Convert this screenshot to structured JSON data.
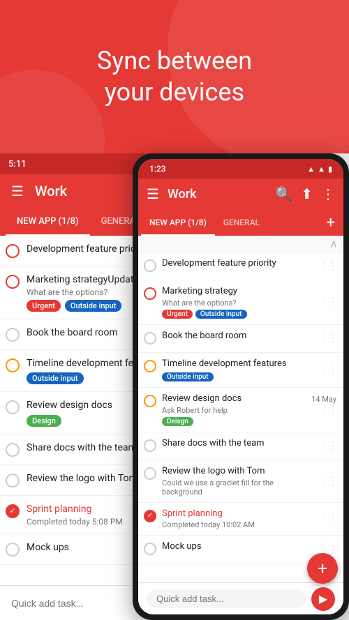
{
  "hero": {
    "title_line1": "Sync between",
    "title_line2": "your devices"
  },
  "status_bar": {
    "time": "5:11",
    "phone_time": "1:23",
    "battery_icon": "🔋",
    "wifi_icon": "▲",
    "signal_icon": "▲"
  },
  "toolbar": {
    "menu_icon": "☰",
    "title": "Work",
    "search_icon": "🔍",
    "share_icon": "⬆",
    "more_icon": "⋮"
  },
  "tabs": {
    "new_app": "NEW APP (1/8)",
    "general": "GENERAL",
    "add_icon": "+"
  },
  "tasks": [
    {
      "id": 1,
      "title": "Development feature priority",
      "subtitle": "",
      "circle": "empty",
      "tags": [],
      "date": "",
      "completed": false
    },
    {
      "id": 2,
      "title": "Marketing strategy",
      "subtitle": "What are the options?",
      "circle": "red-ring",
      "tags": [
        "Urgent",
        "Outside input"
      ],
      "date": "",
      "completed": false
    },
    {
      "id": 3,
      "title": "Book the board room",
      "subtitle": "",
      "circle": "empty",
      "tags": [],
      "date": "",
      "completed": false
    },
    {
      "id": 4,
      "title": "Timeline development features",
      "subtitle": "",
      "circle": "orange-ring",
      "tags": [
        "Outside input"
      ],
      "date": "",
      "completed": false
    },
    {
      "id": 5,
      "title": "Review design docs",
      "subtitle": "Ask Robert for help",
      "circle": "orange-ring",
      "tags": [
        "Deisgn"
      ],
      "date": "14 May",
      "completed": false
    },
    {
      "id": 6,
      "title": "Share docs with the team",
      "subtitle": "",
      "circle": "empty",
      "tags": [],
      "date": "",
      "completed": false
    },
    {
      "id": 7,
      "title": "Review the logo with Tom",
      "subtitle": "Could we use a gradiet fill for the background",
      "circle": "empty",
      "tags": [],
      "date": "",
      "completed": false
    },
    {
      "id": 8,
      "title": "Sprint planning",
      "subtitle": "Completed today 10:02 AM",
      "circle": "completed",
      "tags": [],
      "date": "",
      "completed": true
    },
    {
      "id": 9,
      "title": "Mock ups",
      "subtitle": "",
      "circle": "empty",
      "tags": [],
      "date": "",
      "completed": false
    }
  ],
  "tablet_tasks": [
    {
      "id": 1,
      "title": "Development feature priority",
      "subtitle": "",
      "circle": "red-ring",
      "tags": [],
      "date": "",
      "completed": false
    },
    {
      "id": 2,
      "title": "Marketing strategyUpdate CV",
      "subtitle": "What are the options?",
      "circle": "red-ring",
      "tags": [
        "Urgent",
        "Outside input"
      ],
      "date": "",
      "completed": false
    },
    {
      "id": 3,
      "title": "Book the board room",
      "subtitle": "",
      "circle": "empty",
      "tags": [],
      "date": "",
      "completed": false
    },
    {
      "id": 4,
      "title": "Timeline development features",
      "subtitle": "",
      "circle": "orange-ring",
      "tags": [
        "Outside input"
      ],
      "date": "",
      "completed": false
    },
    {
      "id": 5,
      "title": "Review design docs",
      "subtitle": "",
      "circle": "empty",
      "tags": [
        "Design"
      ],
      "date": "",
      "completed": false
    },
    {
      "id": 6,
      "title": "Share docs with the team",
      "subtitle": "",
      "circle": "empty",
      "tags": [],
      "date": "",
      "completed": false
    },
    {
      "id": 7,
      "title": "Review the logo with Tom",
      "subtitle": "",
      "circle": "empty",
      "tags": [],
      "date": "",
      "completed": false
    },
    {
      "id": 8,
      "title": "Sprint planning",
      "subtitle": "Completed today 5:08 PM",
      "circle": "completed",
      "tags": [],
      "date": "",
      "completed": true
    },
    {
      "id": 9,
      "title": "Mock ups",
      "subtitle": "",
      "circle": "empty",
      "tags": [],
      "date": "",
      "completed": false
    }
  ],
  "quick_add": {
    "placeholder": "Quick add task...",
    "send_icon": "▶"
  },
  "fab": {
    "icon": "+"
  }
}
